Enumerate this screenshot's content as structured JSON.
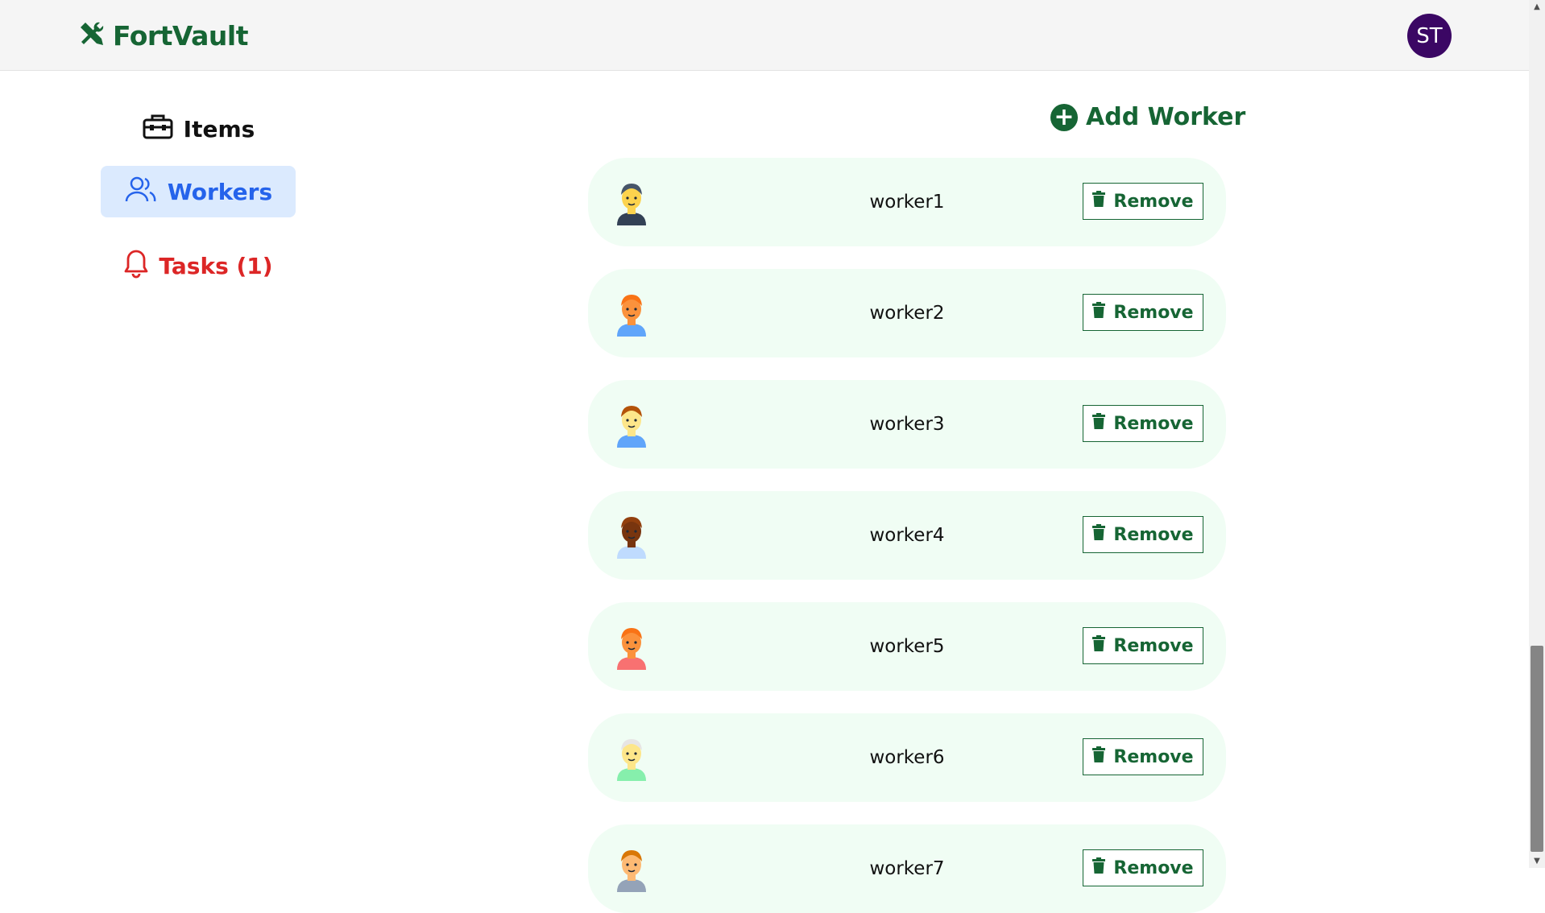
{
  "app": {
    "brand": "FortVault",
    "user_initials": "ST"
  },
  "sidebar": {
    "items": [
      {
        "label": "Items",
        "icon": "toolbox-icon",
        "active": false
      },
      {
        "label": "Workers",
        "icon": "users-icon",
        "active": true
      },
      {
        "label": "Tasks (1)",
        "icon": "bell-icon",
        "active": false
      }
    ]
  },
  "main": {
    "add_label": "Add Worker",
    "remove_label": "Remove",
    "workers": [
      {
        "name": "worker1",
        "avatar": "avatar-turban-icon"
      },
      {
        "name": "worker2",
        "avatar": "avatar-bearded-bald-icon"
      },
      {
        "name": "worker3",
        "avatar": "avatar-curly-beard-icon"
      },
      {
        "name": "worker4",
        "avatar": "avatar-afro-icon"
      },
      {
        "name": "worker5",
        "avatar": "avatar-mustache-icon"
      },
      {
        "name": "worker6",
        "avatar": "avatar-elderly-icon"
      },
      {
        "name": "worker7",
        "avatar": "avatar-worker-icon"
      }
    ]
  },
  "colors": {
    "brand_green": "#166534",
    "row_bg": "#f0fdf4",
    "active_blue": "#2563eb",
    "active_bg": "#dbeafe",
    "alert_red": "#dc2626",
    "avatar_purple": "#3b0764"
  }
}
